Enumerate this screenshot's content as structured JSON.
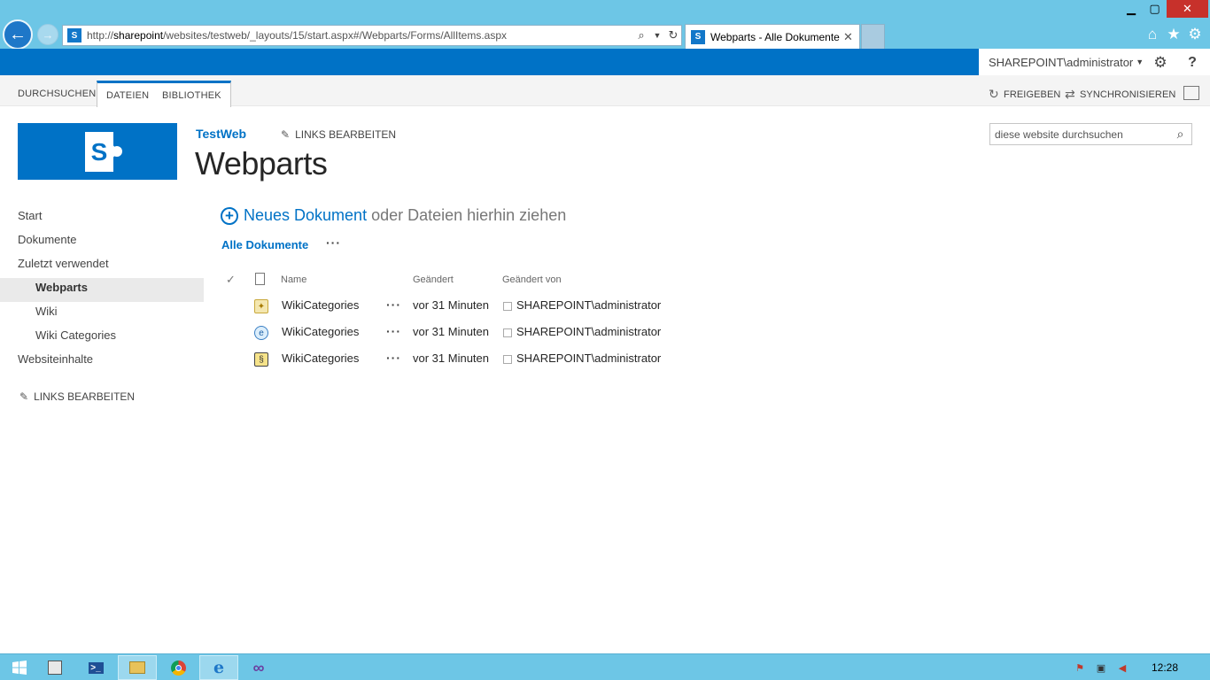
{
  "browser": {
    "address": {
      "prefix": "http://",
      "host": "sharepoint",
      "path": "/websites/testweb/_layouts/15/start.aspx#/Webparts/Forms/AllItems.aspx"
    },
    "tab_title": "Webparts - Alle Dokumente",
    "window_controls": {
      "minimize": "▁",
      "maximize": "▢",
      "close": "✕"
    }
  },
  "suite": {
    "user": "SHAREPOINT\\administrator",
    "gear_icon": "⚙",
    "help_icon": "?"
  },
  "ribbon": {
    "tabs": [
      "DURCHSUCHEN",
      "DATEIEN",
      "BIBLIOTHEK"
    ],
    "share_label": "FREIGEBEN",
    "sync_label": "SYNCHRONISIEREN"
  },
  "header": {
    "site_title": "TestWeb",
    "edit_links": "LINKS BEARBEITEN",
    "page_title": "Webparts",
    "search_placeholder": "diese website durchsuchen"
  },
  "quick_launch": {
    "items": [
      {
        "label": "Start",
        "level": 0,
        "selected": false
      },
      {
        "label": "Dokumente",
        "level": 0,
        "selected": false
      },
      {
        "label": "Zuletzt verwendet",
        "level": 0,
        "selected": false
      },
      {
        "label": "Webparts",
        "level": 1,
        "selected": true
      },
      {
        "label": "Wiki",
        "level": 1,
        "selected": false
      },
      {
        "label": "Wiki Categories",
        "level": 1,
        "selected": false
      },
      {
        "label": "Websiteinhalte",
        "level": 0,
        "selected": false
      }
    ],
    "edit_links": "LINKS BEARBEITEN"
  },
  "library": {
    "new_document_link": "Neues Dokument",
    "new_document_rest": "oder Dateien hierhin ziehen",
    "current_view": "Alle Dokumente",
    "more": "···",
    "columns": {
      "check": "✓",
      "name": "Name",
      "modified": "Geändert",
      "modified_by": "Geändert von"
    },
    "documents": [
      {
        "name": "WikiCategories",
        "icon": "generic-file-icon",
        "modified": "vor 31 Minuten",
        "modified_by": "SHAREPOINT\\administrator"
      },
      {
        "name": "WikiCategories",
        "icon": "html-file-icon",
        "modified": "vor 31 Minuten",
        "modified_by": "SHAREPOINT\\administrator"
      },
      {
        "name": "WikiCategories",
        "icon": "config-file-icon",
        "modified": "vor 31 Minuten",
        "modified_by": "SHAREPOINT\\administrator"
      }
    ]
  },
  "taskbar": {
    "clock": "12:28",
    "apps": [
      "start-button",
      "server-manager",
      "powershell",
      "file-explorer",
      "chrome",
      "internet-explorer",
      "visual-studio"
    ]
  }
}
